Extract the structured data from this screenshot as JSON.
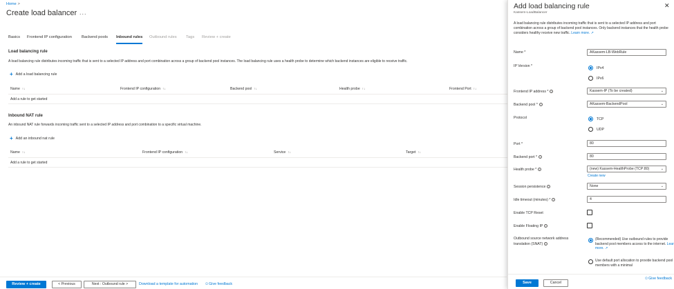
{
  "breadcrumb": {
    "home": "Home",
    "separator": ">"
  },
  "page": {
    "title": "Create load balancer",
    "more": "..."
  },
  "tabs": [
    {
      "label": "Basics",
      "state": "normal"
    },
    {
      "label": "Frontend IP configuration",
      "state": "normal"
    },
    {
      "label": "Backend pools",
      "state": "normal"
    },
    {
      "label": "Inbound rules",
      "state": "active"
    },
    {
      "label": "Outbound rules",
      "state": "disabled"
    },
    {
      "label": "Tags",
      "state": "disabled"
    },
    {
      "label": "Review + create",
      "state": "disabled"
    }
  ],
  "lb_rules": {
    "title": "Load balancing rule",
    "description": "A load balancing rule distributes incoming traffic that is sent to a selected IP address and port combination across a group of backend pool instances. The load balancing rule uses a health probe to determine which backend instances are eligible to receive traffic.",
    "add_label": "Add a load balancing rule",
    "columns": [
      "Name",
      "Frontend IP configuration",
      "Backend pool",
      "Health probe",
      "Frontend Port"
    ],
    "empty": "Add a rule to get started"
  },
  "nat_rules": {
    "title": "Inbound NAT rule",
    "description": "An inbound NAT rule forwards incoming traffic sent to a selected IP address and port combination to a specific virtual machine.",
    "add_label": "Add an inbound nat rule",
    "columns": [
      "Name",
      "Frontend IP configuration",
      "Service",
      "Target"
    ],
    "empty": "Add a rule to get started"
  },
  "footer": {
    "review_create": "Review + create",
    "previous": "< Previous",
    "next": "Next : Outbound rule >",
    "download": "Download a template for automation",
    "feedback": "Give feedback",
    "feedback_icon": "person-feedback-icon"
  },
  "panel": {
    "title": "Add load balancing rule",
    "subtitle": "Kassem-LoadBalancer",
    "description": "A load balancing rule distributes incoming traffic that is sent to a selected IP address and port combination across a group of backend pool instances. Only backend instances that the health probe considers healthy receive new traffic.",
    "learn_more": "Learn more.",
    "fields": {
      "name_label": "Name *",
      "name_value": "AKassem-LB-WebRule",
      "ip_version_label": "IP Version *",
      "ipv4": "IPv4",
      "ipv6": "IPv6",
      "frontend_label": "Frontend IP address *",
      "frontend_value": "Kassem-IP (To be created)",
      "backend_pool_label": "Backend pool *",
      "backend_pool_value": "AKassem-BackendPool",
      "protocol_label": "Protocol",
      "tcp": "TCP",
      "udp": "UDP",
      "port_label": "Port *",
      "port_value": "80",
      "backend_port_label": "Backend port *",
      "backend_port_value": "80",
      "health_probe_label": "Health probe *",
      "health_probe_value": "(new) Kassem-HealthProbe (TCP:80)",
      "create_new": "Create new",
      "session_label": "Session persistence",
      "session_value": "None",
      "idle_label": "Idle timeout (minutes) *",
      "idle_value": "4",
      "tcp_reset_label": "Enable TCP Reset",
      "floating_label": "Enable Floating IP",
      "snat_label_1": "Outbound source network address",
      "snat_label_2": "translation (SNAT)",
      "snat_option_1": "(Recommended) Use outbound rules to provide backend pool members access to the internet.",
      "snat_option_1_link": "Learn more.",
      "snat_option_2": "Use default port allocation to provide backend pool members with a minimal"
    },
    "save": "Save",
    "cancel": "Cancel",
    "feedback": "Give feedback",
    "close_icon": "close-icon"
  },
  "colors": {
    "accent": "#0078d4",
    "text": "#323130",
    "border": "#8a8886"
  }
}
